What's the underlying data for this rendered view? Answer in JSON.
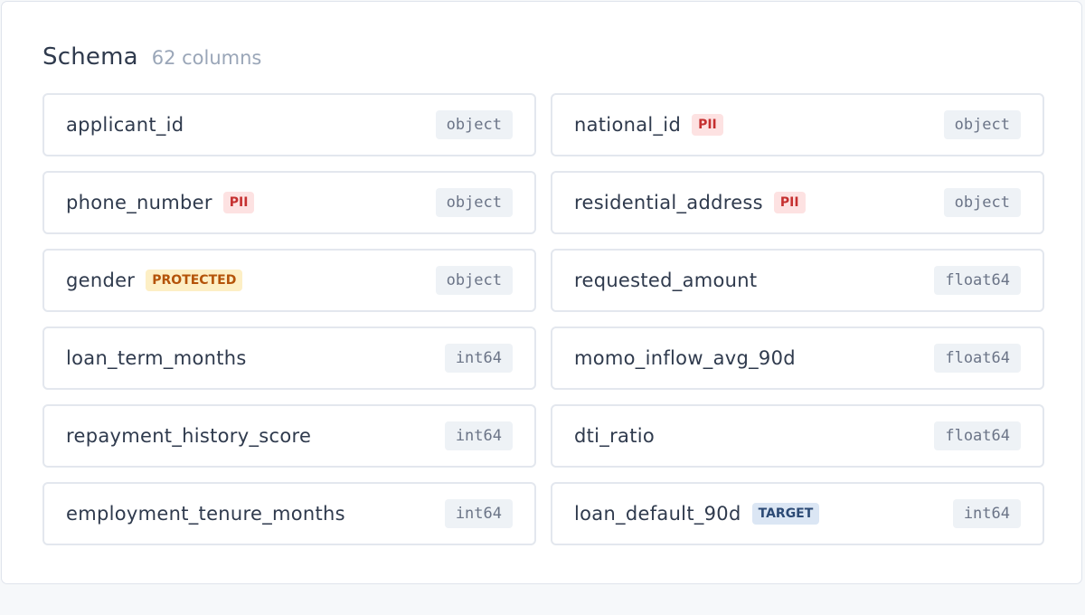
{
  "schema": {
    "title": "Schema",
    "count_label": "62 columns",
    "columns": [
      {
        "name": "applicant_id",
        "badge": "",
        "badge_type": "",
        "dtype": "object"
      },
      {
        "name": "national_id",
        "badge": "PII",
        "badge_type": "pii",
        "dtype": "object"
      },
      {
        "name": "phone_number",
        "badge": "PII",
        "badge_type": "pii",
        "dtype": "object"
      },
      {
        "name": "residential_address",
        "badge": "PII",
        "badge_type": "pii",
        "dtype": "object"
      },
      {
        "name": "gender",
        "badge": "PROTECTED",
        "badge_type": "protected",
        "dtype": "object"
      },
      {
        "name": "requested_amount",
        "badge": "",
        "badge_type": "",
        "dtype": "float64"
      },
      {
        "name": "loan_term_months",
        "badge": "",
        "badge_type": "",
        "dtype": "int64"
      },
      {
        "name": "momo_inflow_avg_90d",
        "badge": "",
        "badge_type": "",
        "dtype": "float64"
      },
      {
        "name": "repayment_history_score",
        "badge": "",
        "badge_type": "",
        "dtype": "int64"
      },
      {
        "name": "dti_ratio",
        "badge": "",
        "badge_type": "",
        "dtype": "float64"
      },
      {
        "name": "employment_tenure_months",
        "badge": "",
        "badge_type": "",
        "dtype": "int64"
      },
      {
        "name": "loan_default_90d",
        "badge": "TARGET",
        "badge_type": "target",
        "dtype": "int64"
      }
    ]
  },
  "colors": {
    "pii_bg": "#fde2e2",
    "pii_text": "#c53030",
    "protected_bg": "#fdefc5",
    "protected_text": "#b45309",
    "target_bg": "#dbe6f4",
    "target_text": "#2c4a75"
  }
}
